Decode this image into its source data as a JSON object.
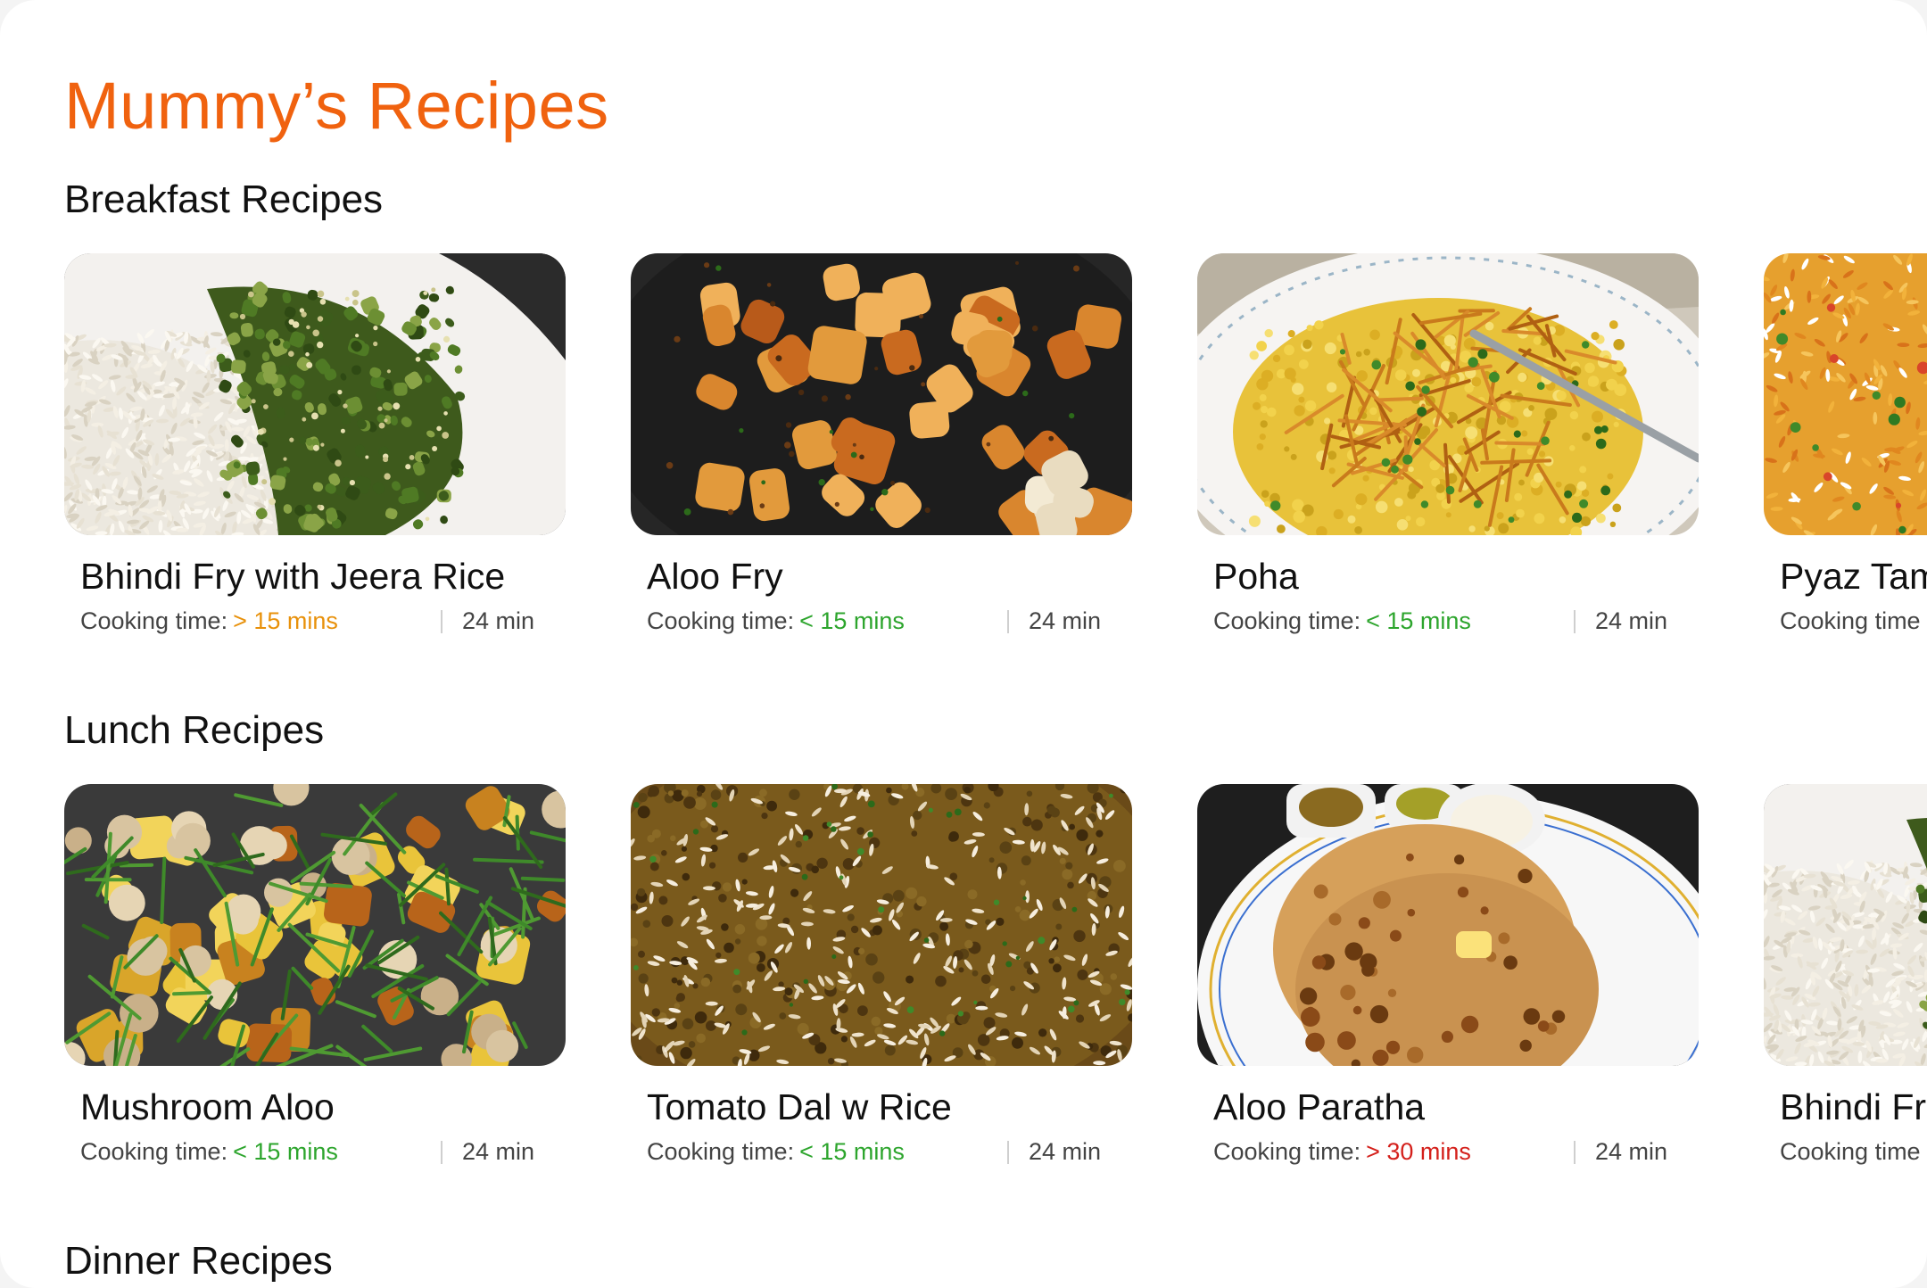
{
  "app": {
    "title": "Mummy’s Recipes"
  },
  "colors": {
    "accent": "#f0620f",
    "fast": "#2da52d",
    "medium": "#e8910b",
    "slow": "#d4201b"
  },
  "sections": [
    {
      "title": "Breakfast Recipes",
      "cards": [
        {
          "name": "Bhindi Fry with Jeera Rice",
          "time_label": "Cooking time:",
          "time_value": "> 15 mins",
          "time_status": "medium",
          "duration": "24 min",
          "image": "bhindi-rice"
        },
        {
          "name": "Aloo Fry",
          "time_label": "Cooking time:",
          "time_value": "< 15 mins",
          "time_status": "fast",
          "duration": "24 min",
          "image": "aloo-fry"
        },
        {
          "name": "Poha",
          "time_label": "Cooking time:",
          "time_value": "< 15 mins",
          "time_status": "fast",
          "duration": "24 min",
          "image": "poha"
        },
        {
          "name": "Pyaz Tam",
          "time_label": "Cooking time",
          "time_value": "",
          "time_status": "fast",
          "duration": "",
          "image": "pyaz-tamatar"
        }
      ]
    },
    {
      "title": "Lunch Recipes",
      "cards": [
        {
          "name": "Mushroom Aloo",
          "time_label": "Cooking time:",
          "time_value": "< 15 mins",
          "time_status": "fast",
          "duration": "24 min",
          "image": "mushroom-aloo"
        },
        {
          "name": "Tomato Dal w Rice",
          "time_label": "Cooking time:",
          "time_value": "< 15 mins",
          "time_status": "fast",
          "duration": "24 min",
          "image": "dal-rice"
        },
        {
          "name": "Aloo Paratha",
          "time_label": "Cooking time:",
          "time_value": "> 30 mins",
          "time_status": "slow",
          "duration": "24 min",
          "image": "aloo-paratha"
        },
        {
          "name": "Bhindi Fr",
          "time_label": "Cooking time",
          "time_value": "",
          "time_status": "fast",
          "duration": "",
          "image": "bhindi-rice"
        }
      ]
    },
    {
      "title": "Dinner Recipes",
      "cards": []
    }
  ]
}
